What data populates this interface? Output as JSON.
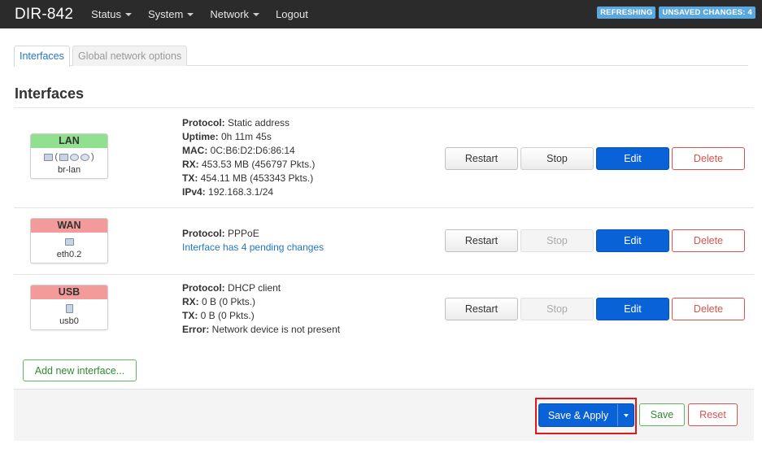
{
  "header": {
    "brand": "DIR-842",
    "menu": [
      {
        "label": "Status",
        "has_dropdown": true
      },
      {
        "label": "System",
        "has_dropdown": true
      },
      {
        "label": "Network",
        "has_dropdown": true
      },
      {
        "label": "Logout",
        "has_dropdown": false
      }
    ],
    "badges": [
      "REFRESHING",
      "UNSAVED CHANGES: 4"
    ]
  },
  "tabs": [
    {
      "label": "Interfaces",
      "active": true
    },
    {
      "label": "Global network options",
      "active": false
    }
  ],
  "section_title": "Interfaces",
  "interfaces": [
    {
      "name": "LAN",
      "status_color": "#90e090",
      "device": "br-lan",
      "info": [
        {
          "key": "Protocol:",
          "value": " Static address"
        },
        {
          "key": "Uptime:",
          "value": " 0h 11m 45s"
        },
        {
          "key": "MAC:",
          "value": " 0C:B6:D2:D6:86:14"
        },
        {
          "key": "RX:",
          "value": " 453.53 MB (456797 Pkts.)"
        },
        {
          "key": "TX:",
          "value": " 454.11 MB (453343 Pkts.)"
        },
        {
          "key": "IPv4:",
          "value": " 192.168.3.1/24"
        }
      ],
      "pending": "",
      "stop_enabled": true
    },
    {
      "name": "WAN",
      "status_color": "#f39a9a",
      "device": "eth0.2",
      "info": [
        {
          "key": "Protocol:",
          "value": " PPPoE"
        }
      ],
      "pending": "Interface has 4 pending changes",
      "stop_enabled": false
    },
    {
      "name": "USB",
      "status_color": "#f39a9a",
      "device": "usb0",
      "info": [
        {
          "key": "Protocol:",
          "value": " DHCP client"
        },
        {
          "key": "RX:",
          "value": " 0 B (0 Pkts.)"
        },
        {
          "key": "TX:",
          "value": " 0 B (0 Pkts.)"
        },
        {
          "key": "Error:",
          "value": " Network device is not present"
        }
      ],
      "pending": "",
      "stop_enabled": false
    }
  ],
  "row_buttons": {
    "restart": "Restart",
    "stop": "Stop",
    "edit": "Edit",
    "delete": "Delete"
  },
  "add_interface_label": "Add new interface...",
  "footer": {
    "save_apply": "Save & Apply",
    "save": "Save",
    "reset": "Reset"
  },
  "colors": {
    "header_bg": "#2b2b2b",
    "primary": "#0a62d8",
    "danger": "#d9534f",
    "success": "#5cb85c",
    "badge": "#5aa8e0",
    "highlight": "#e01818"
  }
}
